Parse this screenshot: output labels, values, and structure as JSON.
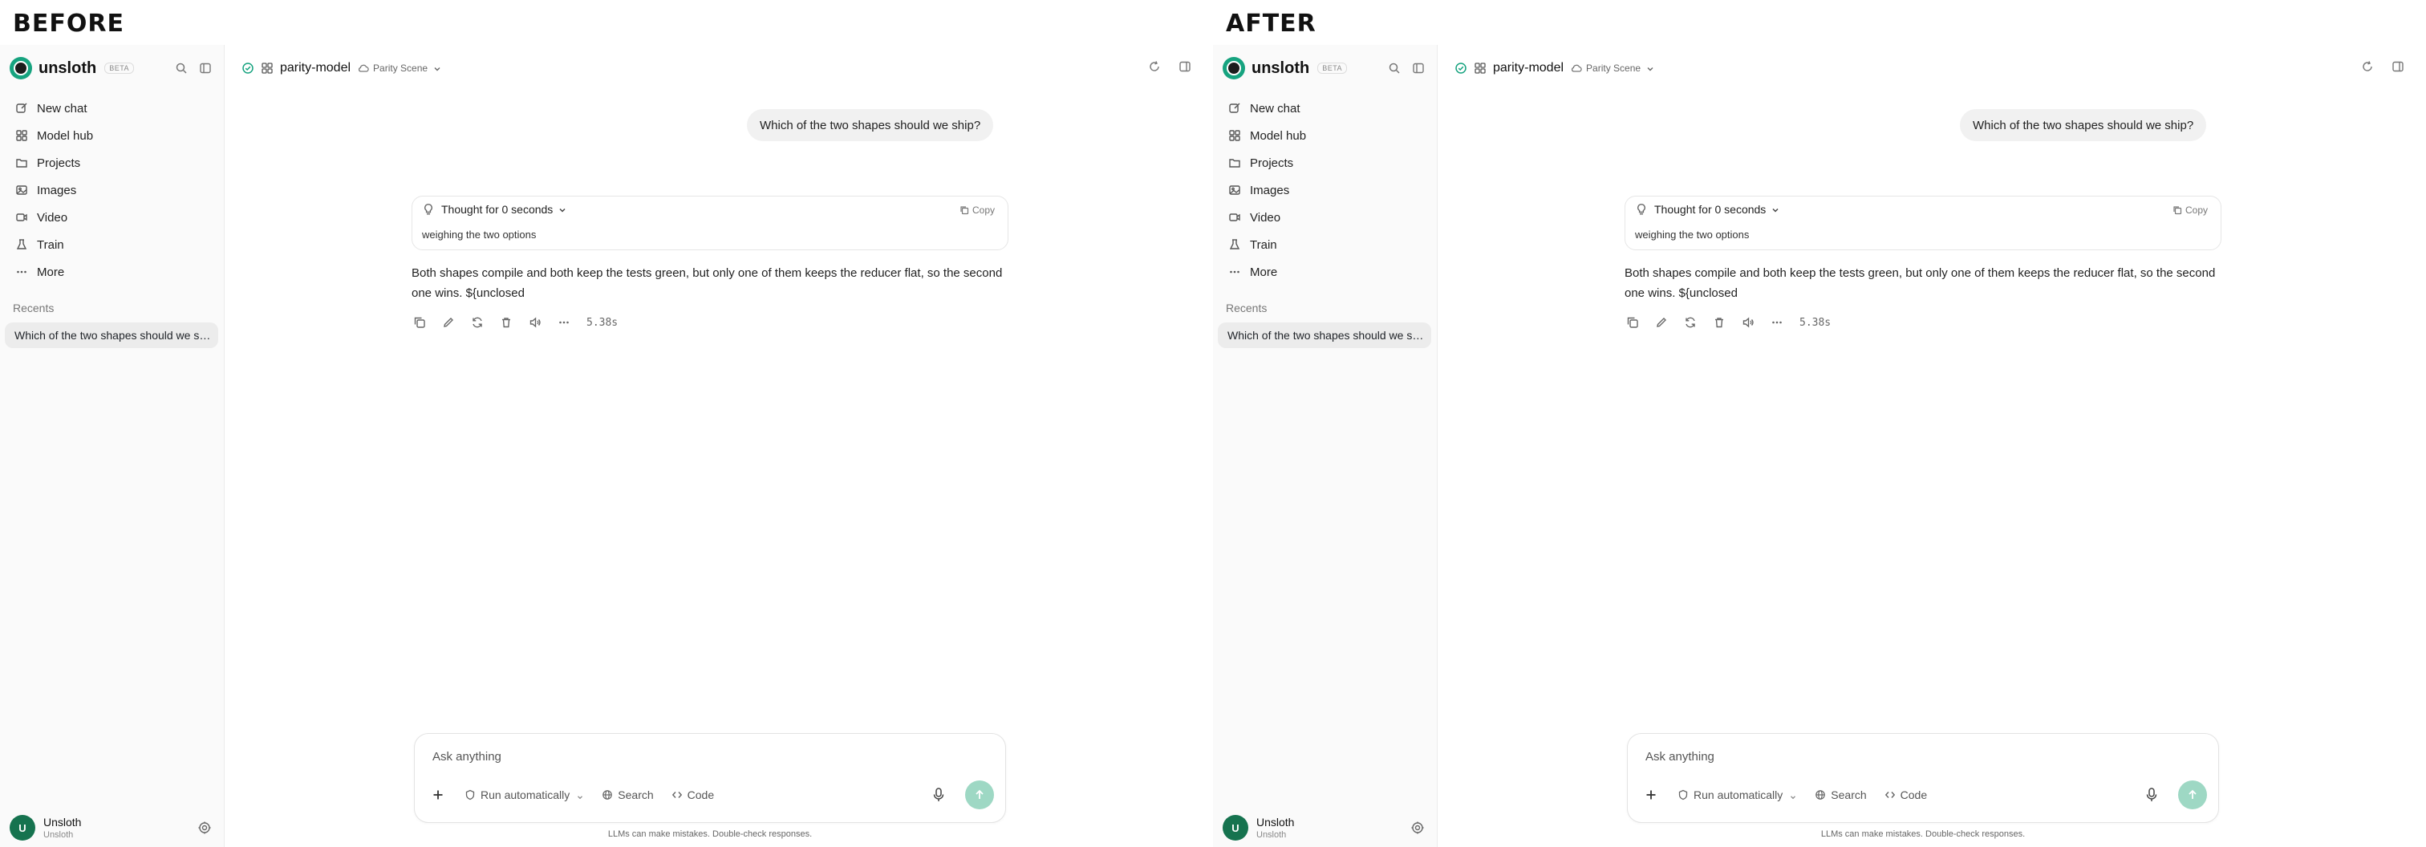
{
  "panels": [
    {
      "label": "BEFORE",
      "brand": {
        "name": "unsloth",
        "badge": "BETA"
      },
      "nav": [
        "New chat",
        "Model hub",
        "Projects",
        "Images",
        "Video",
        "Train",
        "More"
      ],
      "recents_title": "Recents",
      "recent_item": "Which of the two shapes should we ship?",
      "user": {
        "initial": "U",
        "name": "Unsloth",
        "sub": "Unsloth"
      },
      "model": {
        "name": "parity-model",
        "scene": "Parity Scene"
      },
      "user_message": "Which of the two shapes should we ship?",
      "thought": {
        "title": "Thought for 0 seconds",
        "copy_label": "Copy",
        "text": "weighing the two options"
      },
      "answer": "Both shapes compile and both keep the tests green, but only one of them keeps the reducer flat, so the second one wins. ${unclosed",
      "time": "5.38s",
      "composer": {
        "placeholder": "Ask anything",
        "run": "Run automatically",
        "search": "Search",
        "code": "Code"
      },
      "disclaimer": "LLMs can make mistakes. Double-check responses."
    },
    {
      "label": "AFTER",
      "brand": {
        "name": "unsloth",
        "badge": "BETA"
      },
      "nav": [
        "New chat",
        "Model hub",
        "Projects",
        "Images",
        "Video",
        "Train",
        "More"
      ],
      "recents_title": "Recents",
      "recent_item": "Which of the two shapes should we ship?",
      "user": {
        "initial": "U",
        "name": "Unsloth",
        "sub": "Unsloth"
      },
      "model": {
        "name": "parity-model",
        "scene": "Parity Scene"
      },
      "user_message": "Which of the two shapes should we ship?",
      "thought": {
        "title": "Thought for 0 seconds",
        "copy_label": "Copy",
        "text": "weighing the two options"
      },
      "answer": "Both shapes compile and both keep the tests green, but only one of them keeps the reducer flat, so the second one wins. ${unclosed",
      "time": "5.38s",
      "composer": {
        "placeholder": "Ask anything",
        "run": "Run automatically",
        "search": "Search",
        "code": "Code"
      },
      "disclaimer": "LLMs can make mistakes. Double-check responses."
    }
  ],
  "colors": {
    "accent": "#16a37f",
    "send_disabled": "#9ed8c4",
    "avatar": "#16734f"
  }
}
